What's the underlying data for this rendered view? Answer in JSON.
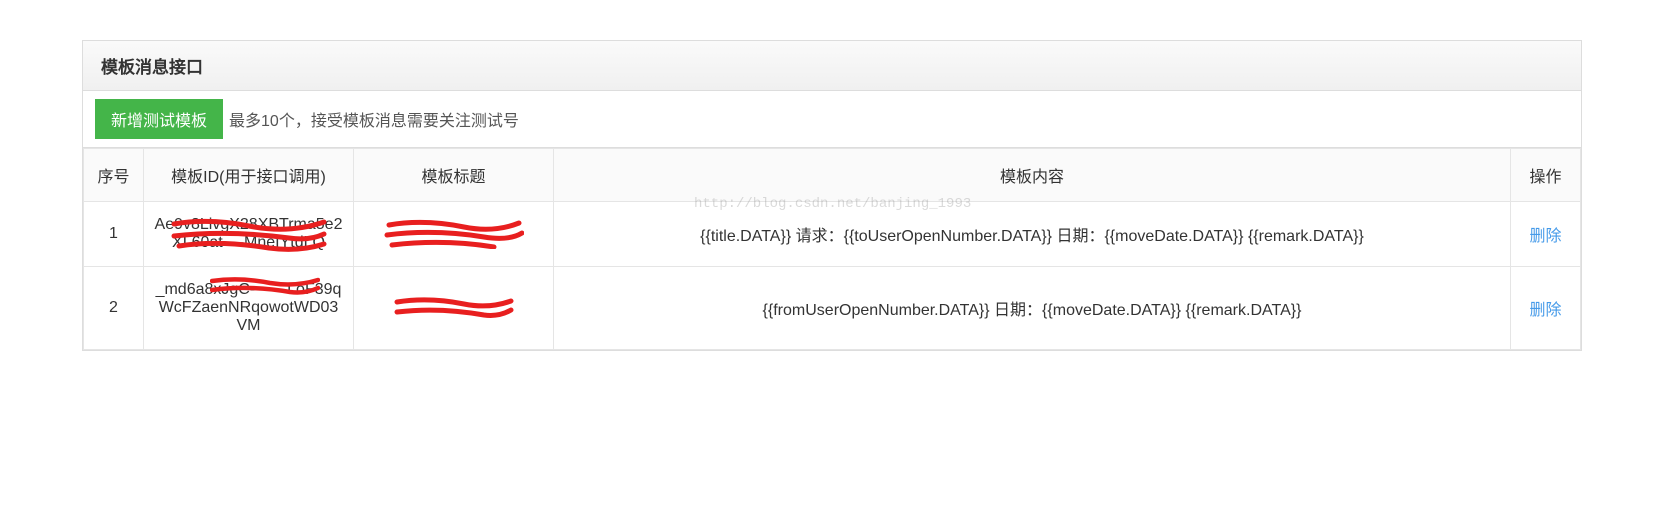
{
  "panel": {
    "title": "模板消息接口"
  },
  "toolbar": {
    "add_button": "新增测试模板",
    "note": "最多10个，接受模板消息需要关注测试号"
  },
  "table": {
    "headers": {
      "seq": "序号",
      "id": "模板ID(用于接口调用)",
      "title": "模板标题",
      "content": "模板内容",
      "action": "操作"
    },
    "rows": [
      {
        "seq": "1",
        "id": "Ae9v8LivgX28XBTrma5e2XL60at----MneIYtdLQ",
        "title": "",
        "content": "{{title.DATA}} 请求：{{toUserOpenNumber.DATA}} 日期：{{moveDate.DATA}} {{remark.DATA}}",
        "action": "删除"
      },
      {
        "seq": "2",
        "id": "_md6a8xJgC-------LoF39qWcFZaenNRqowotWD03VM",
        "title": "",
        "content": "{{fromUserOpenNumber.DATA}} 日期：{{moveDate.DATA}} {{remark.DATA}}",
        "action": "删除"
      }
    ]
  },
  "watermark": "http://blog.csdn.net/banjing_1993"
}
